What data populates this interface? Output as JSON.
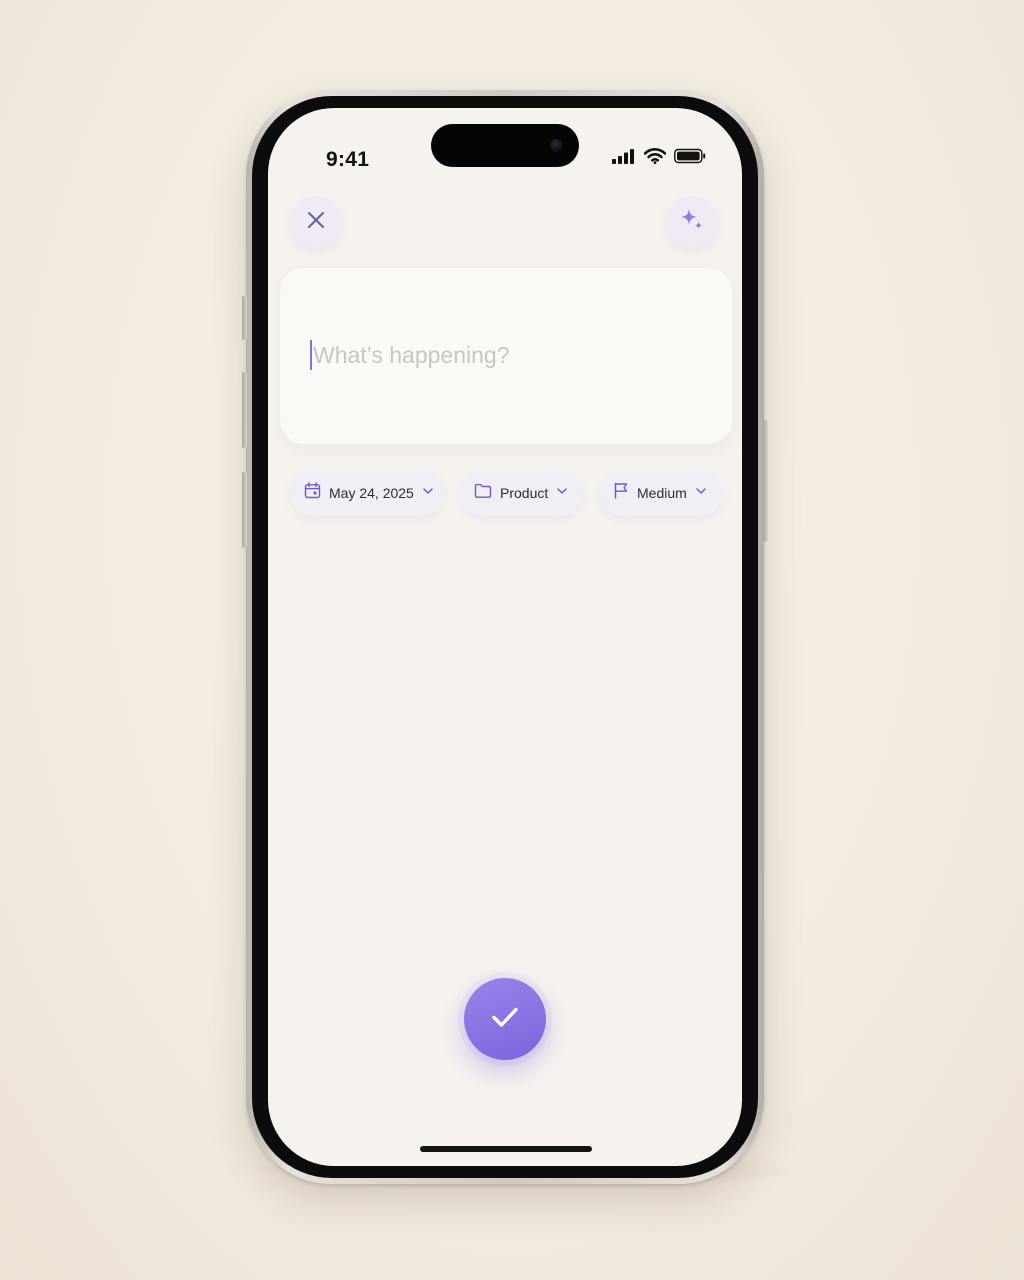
{
  "status_bar": {
    "time": "9:41",
    "signal_icon": "cellular-signal-icon",
    "wifi_icon": "wifi-icon",
    "battery_icon": "battery-icon"
  },
  "header": {
    "close_icon": "close-icon",
    "ai_icon": "sparkle-icon"
  },
  "composer": {
    "placeholder": "What’s happening?",
    "value": ""
  },
  "chips": {
    "date": {
      "label": "May 24, 2025",
      "icon": "calendar-icon"
    },
    "project": {
      "label": "Product",
      "icon": "folder-icon"
    },
    "priority": {
      "label": "Medium",
      "icon": "flag-icon"
    }
  },
  "submit": {
    "icon": "checkmark-icon"
  },
  "colors": {
    "accent": "#8066dd",
    "screen_background": "#f6f3ef",
    "chip_background": "#f2eef5",
    "placeholder_text": "#c9c5c1"
  }
}
